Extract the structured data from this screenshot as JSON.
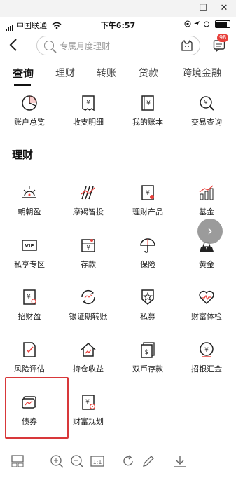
{
  "window": {
    "min_glyph": "—",
    "max_glyph": "☐",
    "close_glyph": "✕"
  },
  "status": {
    "carrier": "中国联通",
    "time": "下午6:57"
  },
  "header": {
    "search_placeholder": "专属月度理财",
    "message_badge": "98"
  },
  "tabs": [
    "查询",
    "理财",
    "转账",
    "贷款",
    "跨境金融"
  ],
  "query_items": [
    {
      "label": "账户总览",
      "icon": "pie-chart-icon"
    },
    {
      "label": "收支明细",
      "icon": "receipt-icon"
    },
    {
      "label": "我的账本",
      "icon": "ledger-icon"
    },
    {
      "label": "交易查询",
      "icon": "search-icon"
    }
  ],
  "section_title": "理财",
  "finance_items": [
    {
      "label": "朝朝盈",
      "icon": "sunrise-icon"
    },
    {
      "label": "摩羯智投",
      "icon": "smart-invest-icon"
    },
    {
      "label": "理财产品",
      "icon": "finance-product-icon"
    },
    {
      "label": "基金",
      "icon": "fund-chart-icon"
    },
    {
      "label": "私享专区",
      "icon": "vip-icon"
    },
    {
      "label": "存款",
      "icon": "deposit-icon"
    },
    {
      "label": "保险",
      "icon": "umbrella-icon"
    },
    {
      "label": "黄金",
      "icon": "gold-icon"
    },
    {
      "label": "招财盈",
      "icon": "zhaocaiying-icon"
    },
    {
      "label": "银证期转账",
      "icon": "transfer-cycle-icon"
    },
    {
      "label": "私募",
      "icon": "private-fund-icon"
    },
    {
      "label": "财富体检",
      "icon": "heart-check-icon"
    },
    {
      "label": "风险评估",
      "icon": "risk-assessment-icon"
    },
    {
      "label": "持仓收益",
      "icon": "holdings-icon"
    },
    {
      "label": "双币存款",
      "icon": "dual-currency-icon"
    },
    {
      "label": "招银汇金",
      "icon": "cmb-gold-icon"
    },
    {
      "label": "债券",
      "icon": "bond-icon"
    },
    {
      "label": "财富规划",
      "icon": "wealth-plan-icon"
    }
  ],
  "float_button_glyph": "›",
  "colors": {
    "accent": "#e8403b",
    "highlight": "#d8383a",
    "text": "#222222"
  }
}
